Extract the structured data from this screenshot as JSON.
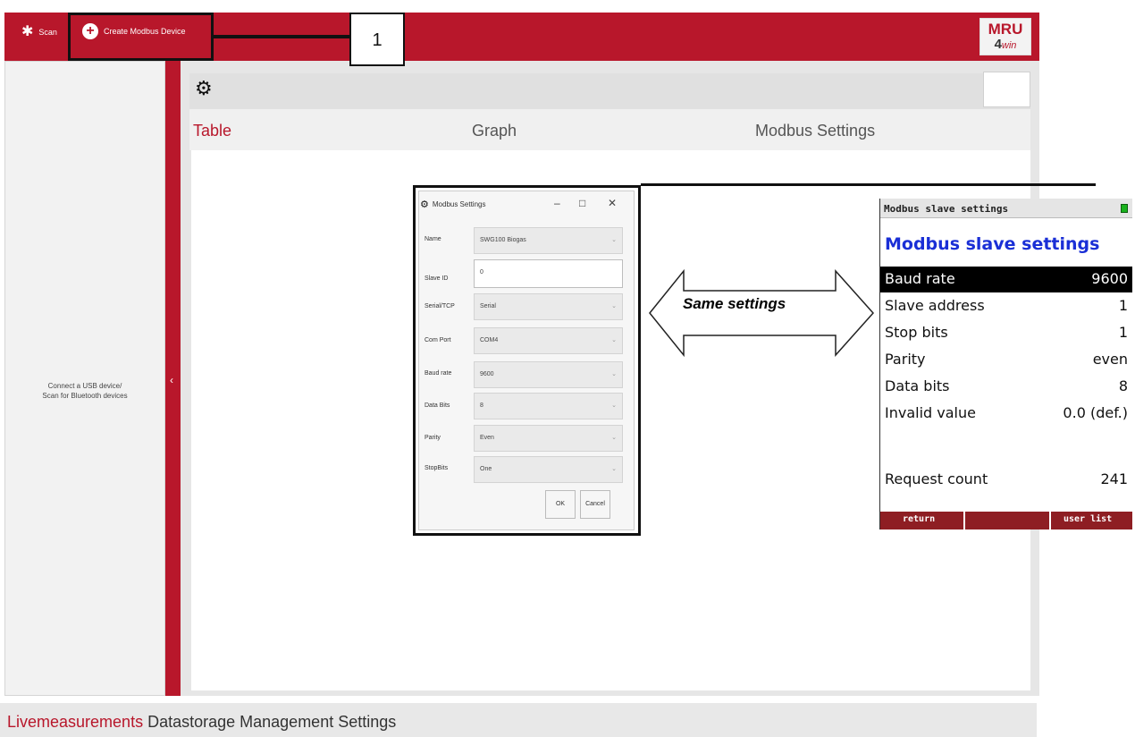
{
  "topbar": {
    "scan_label": "Scan",
    "create_label": "Create Modbus Device",
    "logo_line1": "MRU",
    "logo_line2_num": "4",
    "logo_line2_txt": "win"
  },
  "callout": {
    "number": "1"
  },
  "left_panel": {
    "message_line1": "Connect a USB device/",
    "message_line2": "Scan for Bluetooth devices",
    "collapse_glyph": "‹"
  },
  "tabs": [
    {
      "label": "Table"
    },
    {
      "label": "Graph"
    },
    {
      "label": "Modbus Settings"
    }
  ],
  "bottom_nav": [
    {
      "label": "Livemeasurements"
    },
    {
      "label": "Datastorage"
    },
    {
      "label": "Management"
    },
    {
      "label": "Settings"
    }
  ],
  "dialog": {
    "title": "Modbus Settings",
    "fields": [
      {
        "label": "Name",
        "value": "SWG100 Biogas"
      },
      {
        "label": "Slave ID",
        "value": "0"
      },
      {
        "label": "Serial/TCP",
        "value": "Serial"
      },
      {
        "label": "Com Port",
        "value": "COM4"
      },
      {
        "label": "Baud rate",
        "value": "9600"
      },
      {
        "label": "Data Bits",
        "value": "8"
      },
      {
        "label": "Parity",
        "value": "Even"
      },
      {
        "label": "StopBits",
        "value": "One"
      }
    ],
    "ok_label": "OK",
    "cancel_label": "Cancel"
  },
  "comparison_label": "Same settings",
  "device": {
    "header": "Modbus slave settings",
    "title": "Modbus slave settings",
    "rows": [
      {
        "key": "Baud rate",
        "value": "9600"
      },
      {
        "key": "Slave address",
        "value": "1"
      },
      {
        "key": "Stop bits",
        "value": "1"
      },
      {
        "key": "Parity",
        "value": "even"
      },
      {
        "key": "Data bits",
        "value": "8"
      },
      {
        "key": "Invalid value",
        "value": "0.0 (def.)"
      },
      {
        "key": "Request count",
        "value": "241"
      }
    ],
    "footer_left": "return",
    "footer_right": "user list"
  }
}
